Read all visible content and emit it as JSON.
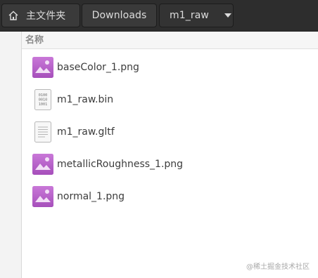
{
  "pathbar": {
    "home_label": "主文件夹",
    "downloads_label": "Downloads",
    "current_label": "m1_raw"
  },
  "list": {
    "column_name": "名称",
    "files": [
      {
        "name": "baseColor_1.png",
        "type": "image"
      },
      {
        "name": "m1_raw.bin",
        "type": "binary"
      },
      {
        "name": "m1_raw.gltf",
        "type": "text"
      },
      {
        "name": "metallicRoughness_1.png",
        "type": "image"
      },
      {
        "name": "normal_1.png",
        "type": "image"
      }
    ]
  },
  "watermark": "@稀土掘金技术社区",
  "colors": {
    "pathbar_bg": "#2d2d2d",
    "image_icon": "#b560c8",
    "text": "#3c3c3c"
  }
}
